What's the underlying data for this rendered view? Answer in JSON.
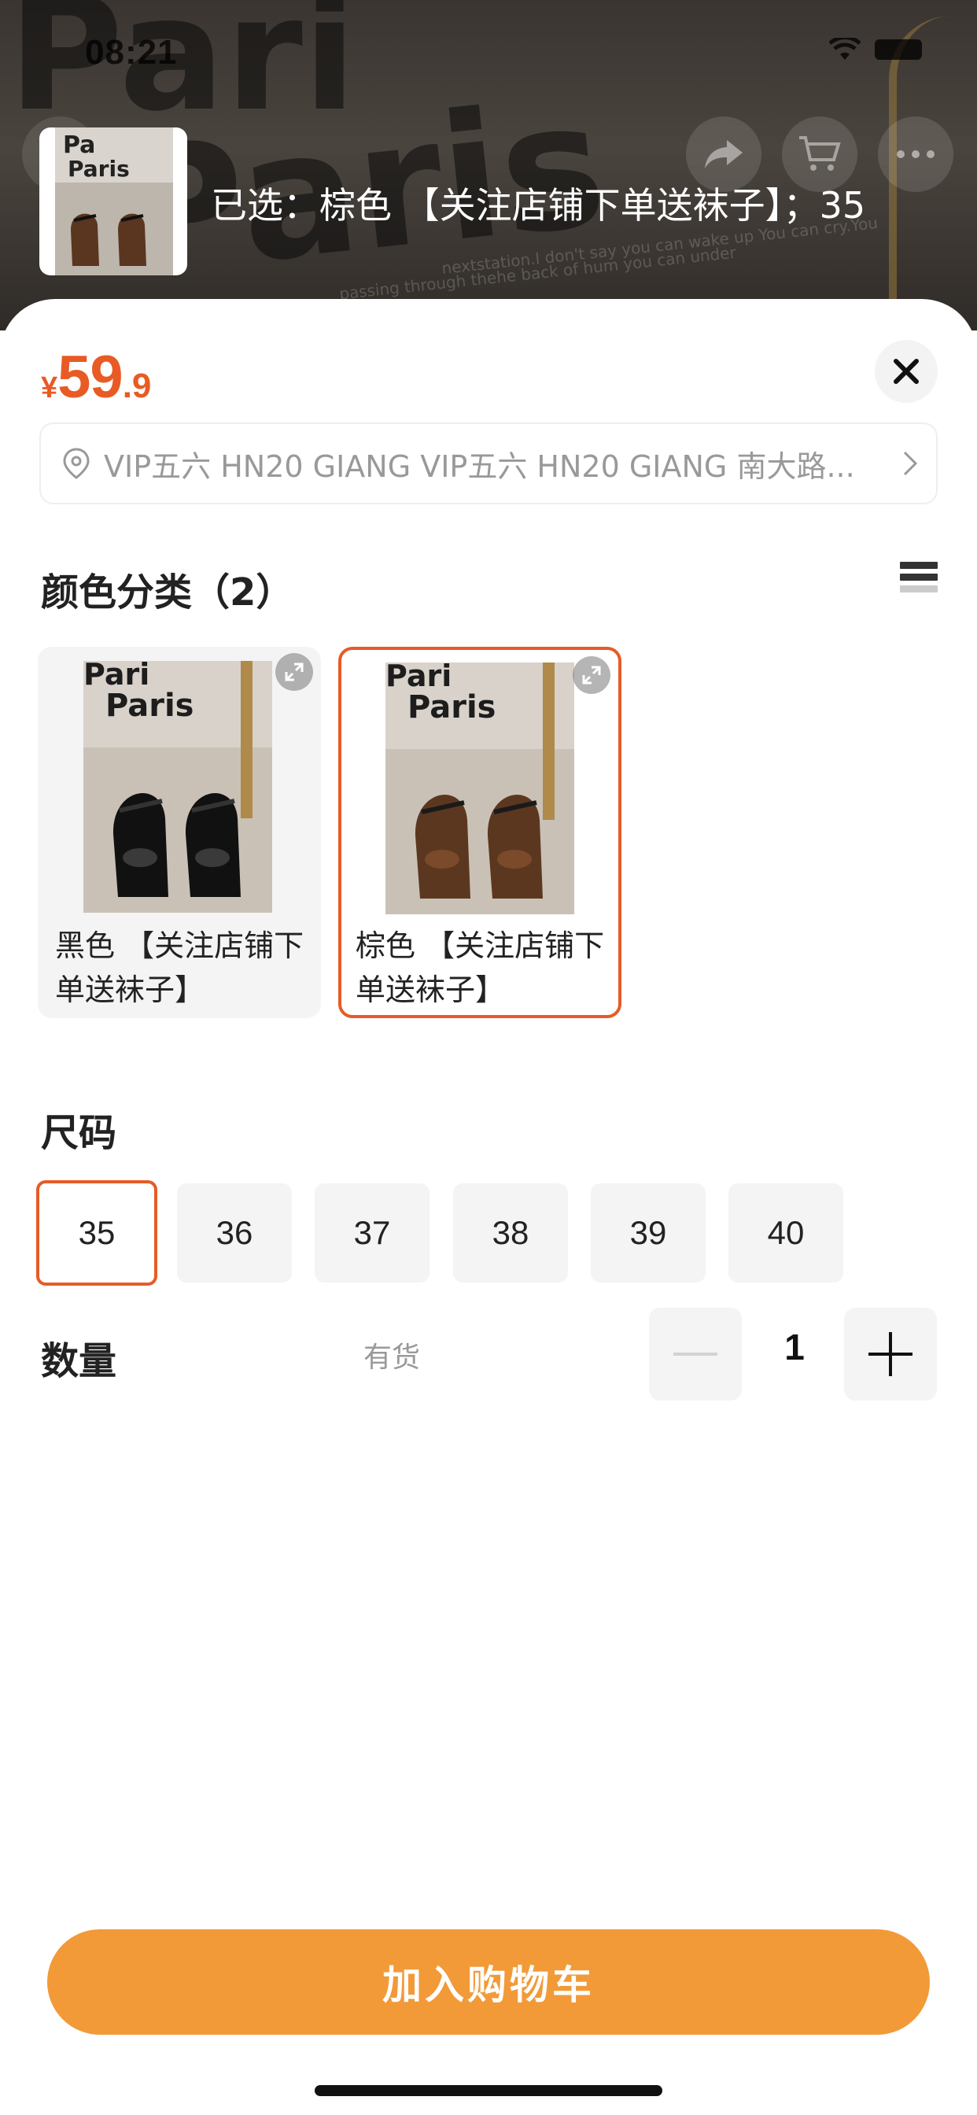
{
  "status_bar": {
    "time": "08:21"
  },
  "header": {
    "selected_text": "已选：棕色 【关注店铺下单送袜子】；35"
  },
  "price": {
    "currency": "¥",
    "integer": "59",
    "decimal": ".9"
  },
  "address": {
    "text": "VIP五六 HN20 GIANG VIP五六 HN20 GIANG 南大路..."
  },
  "color_section": {
    "title": "颜色分类（2）",
    "options": [
      {
        "label": "黑色 【关注店铺下单送袜子】",
        "selected": false
      },
      {
        "label": "棕色 【关注店铺下单送袜子】",
        "selected": true
      }
    ]
  },
  "size_section": {
    "title": "尺码",
    "options": [
      "35",
      "36",
      "37",
      "38",
      "39",
      "40"
    ],
    "selected": "35"
  },
  "quantity_section": {
    "title": "数量",
    "stock_label": "有货",
    "value": "1"
  },
  "add_to_cart_label": "加入购物车",
  "image_text": {
    "product_photo_sign": "Paris"
  },
  "colors": {
    "accent": "#e65c28",
    "price": "#e85b24",
    "button": "#f29a38"
  }
}
